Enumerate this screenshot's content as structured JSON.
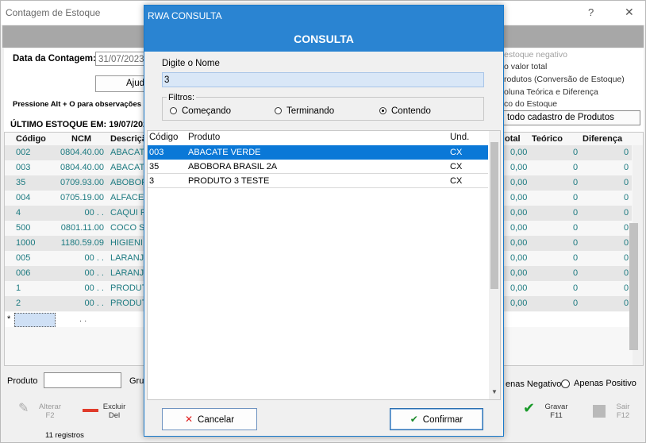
{
  "background_window": {
    "title": "Contagem de Estoque",
    "help": "?",
    "close": "✕",
    "date_label": "Data da Contagem:",
    "date_value": "31/07/2023",
    "ajuda_label": "Ajud",
    "hint": "Pressione Alt + O para observações n",
    "last_stock": "ÚLTIMO ESTOQUE EM: 19/07/2023",
    "right_options": [
      "estoque negativo",
      "o valor total",
      "rodutos (Conversão de Estoque)",
      "oluna Teórica e Diferença",
      "co do Estoque"
    ],
    "products_button": "todo cadastro de Produtos",
    "columns": [
      "Código",
      "NCM",
      "Descriçã",
      "otal",
      "Teórico",
      "Diferença"
    ],
    "rows": [
      {
        "code": "002",
        "ncm": "0804.40.00",
        "desc": "ABACATE",
        "total": "0,00",
        "teorico": "0",
        "dif": "0"
      },
      {
        "code": "003",
        "ncm": "0804.40.00",
        "desc": "ABACATE",
        "total": "0,00",
        "teorico": "0",
        "dif": "0"
      },
      {
        "code": "35",
        "ncm": "0709.93.00",
        "desc": "ABOBOR",
        "total": "0,00",
        "teorico": "0",
        "dif": "0"
      },
      {
        "code": "004",
        "ncm": "0705.19.00",
        "desc": "ALFACE",
        "total": "0,00",
        "teorico": "0",
        "dif": "0"
      },
      {
        "code": "4",
        "ncm": "00 .  .",
        "desc": "CAQUI R",
        "total": "0,00",
        "teorico": "0",
        "dif": "0"
      },
      {
        "code": "500",
        "ncm": "0801.11.00",
        "desc": "COCO SE",
        "total": "0,00",
        "teorico": "0",
        "dif": "0"
      },
      {
        "code": "1000",
        "ncm": "1180.59.09",
        "desc": "HIGIENI",
        "total": "0,00",
        "teorico": "0",
        "dif": "0"
      },
      {
        "code": "005",
        "ncm": "00 .  .",
        "desc": "LARANJA",
        "total": "0,00",
        "teorico": "0",
        "dif": "0"
      },
      {
        "code": "006",
        "ncm": "00 .  .",
        "desc": "LARANJA",
        "total": "0,00",
        "teorico": "0",
        "dif": "0"
      },
      {
        "code": "1",
        "ncm": "00 .  .",
        "desc": "PRODUT",
        "total": "0,00",
        "teorico": "0",
        "dif": "0"
      },
      {
        "code": "2",
        "ncm": "00 .  .",
        "desc": "PRODUT",
        "total": "0,00",
        "teorico": "0",
        "dif": "0"
      }
    ],
    "new_row_marker": "*",
    "new_row_ncm": ". .",
    "produto_label": "Produto",
    "grupo_label": "Grup",
    "negativo_label": "enas Negativo",
    "positivo_label": "Apenas Positivo",
    "toolbar": {
      "alterar": "Alterar",
      "alterar_key": "F2",
      "excluir": "Excluir",
      "excluir_key": "Del",
      "gravar": "Gravar",
      "gravar_key": "F11",
      "sair": "Sair",
      "sair_key": "F12"
    },
    "records": "11 registros"
  },
  "modal": {
    "window_title": "RWA CONSULTA",
    "heading": "CONSULTA",
    "search_label": "Digite o Nome",
    "search_value": "3",
    "filters_label": "Filtros:",
    "filters": [
      {
        "label": "Começando",
        "selected": false
      },
      {
        "label": "Terminando",
        "selected": false
      },
      {
        "label": "Contendo",
        "selected": true
      }
    ],
    "columns": [
      "Código",
      "Produto",
      "Und."
    ],
    "rows": [
      {
        "code": "003",
        "product": "ABACATE VERDE",
        "unit": "CX",
        "selected": true
      },
      {
        "code": "35",
        "product": "ABOBORA BRASIL 2A",
        "unit": "CX",
        "selected": false
      },
      {
        "code": "3",
        "product": "PRODUTO 3 TESTE",
        "unit": "CX",
        "selected": false
      }
    ],
    "cancel_label": "Cancelar",
    "confirm_label": "Confirmar"
  }
}
